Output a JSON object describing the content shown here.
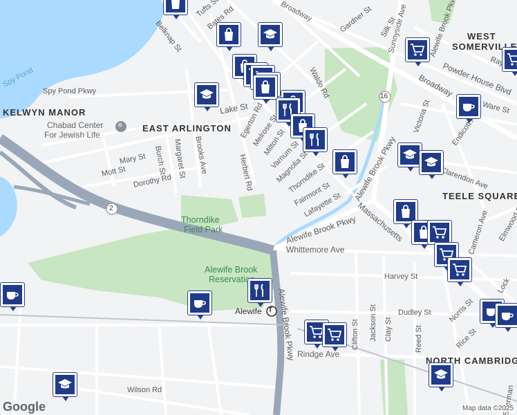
{
  "colors": {
    "water": "#aadaff",
    "park": "#c8e6c1",
    "highway": "#9aa7b8",
    "road": "#ffffff",
    "poi_fill": "#1f3b8a",
    "park_label": "#3d8a52",
    "water_label": "#5ea5c8"
  },
  "labels": {
    "spy_pond": "Spy Pond",
    "spy_pond_pkwy": "Spy Pond Pkwy",
    "kelwyn_manor": "KELWYN MANOR",
    "east_arlington": "EAST ARLINGTON",
    "chabad_line1": "Chabad Center",
    "chabad_line2": "For Jewish Life",
    "thorndike_park_l1": "Thorndike",
    "thorndike_park_l2": "Field Park",
    "alewife_res_l1": "Alewife Brook",
    "alewife_res_l2": "Reservation",
    "alewife_station": "Alewife",
    "west_somerville_l1": "WEST",
    "west_somerville_l2": "SOMERVILLE",
    "teele_square": "TEELE SQUARE",
    "north_cambridge": "NORTH CAMBRIDGE",
    "route2": "2",
    "route16": "16"
  },
  "streets": {
    "belknap": "Belknap St",
    "tufts": "Tufts St",
    "bates": "Bates Rd",
    "broadway_top": "Broadway",
    "gardner": "Gardner St",
    "silk": "Silk St",
    "sunnyside": "Sunnyside Ave",
    "alewife_pkwy_top": "Alewife Brook Pkwy",
    "raymond": "Raymond",
    "powder_house": "Powder House Blvd",
    "broadway": "Broadway",
    "ware": "Ware St",
    "victoria": "Victoria St",
    "lake": "Lake St",
    "waldo": "Waldo Rd",
    "egerton": "Egerton Rd",
    "melrose": "Melrose St",
    "milton": "Milton St",
    "varnum": "Varnum St",
    "magnolia": "Magnolia St",
    "thorndike": "Thorndike St",
    "fairmont": "Fairmont St",
    "lafayette": "Lafayette St",
    "herbert": "Herbert Rd",
    "brooks": "Brooks Ave",
    "margaret": "Margaret St",
    "burch": "Burch St",
    "mary": "Mary St",
    "mott": "Mott St",
    "dorothy": "Dorothy Rd",
    "alewife_pkwy_mid": "Alewife Brook Pkwy",
    "alewife_pkwy_diag": "Alewife Brook Pkwy",
    "massachusetts": "Massachusetts",
    "whittemore": "Whittemore Ave",
    "harvey": "Harvey St",
    "dudley": "Dudley St",
    "norris": "Norris St",
    "rice": "Rice St",
    "clifton": "Clifton St",
    "jackson": "Jackson St",
    "clay": "Clay St",
    "reed": "Reed St",
    "rindge": "Rindge Ave",
    "alewife_pkwy_south": "Alewife Brook Pkwy",
    "wilson": "Wilson Rd",
    "clarendon": "Clarendon Ave",
    "elmwood": "Elmwood St",
    "cameron": "Cameron Ave",
    "endicott": "Endicott Ave",
    "lock": "Lock",
    "sherman": "Sherman"
  },
  "footer": {
    "logo": "Google",
    "attribution": "Map data ©2025"
  },
  "pois": [
    {
      "kind": "shop",
      "name": "shopping-bag-marker"
    },
    {
      "kind": "school",
      "name": "school-marker"
    },
    {
      "kind": "shop",
      "name": "shopping-bag-marker"
    },
    {
      "kind": "cart",
      "name": "grocery-cart-marker"
    },
    {
      "kind": "shop",
      "name": "shopping-bag-marker"
    },
    {
      "kind": "food",
      "name": "restaurant-marker"
    },
    {
      "kind": "school",
      "name": "school-marker"
    },
    {
      "kind": "coffee",
      "name": "cafe-marker"
    },
    {
      "kind": "cart",
      "name": "grocery-cart-marker"
    },
    {
      "kind": "coffee",
      "name": "cafe-marker"
    }
  ]
}
